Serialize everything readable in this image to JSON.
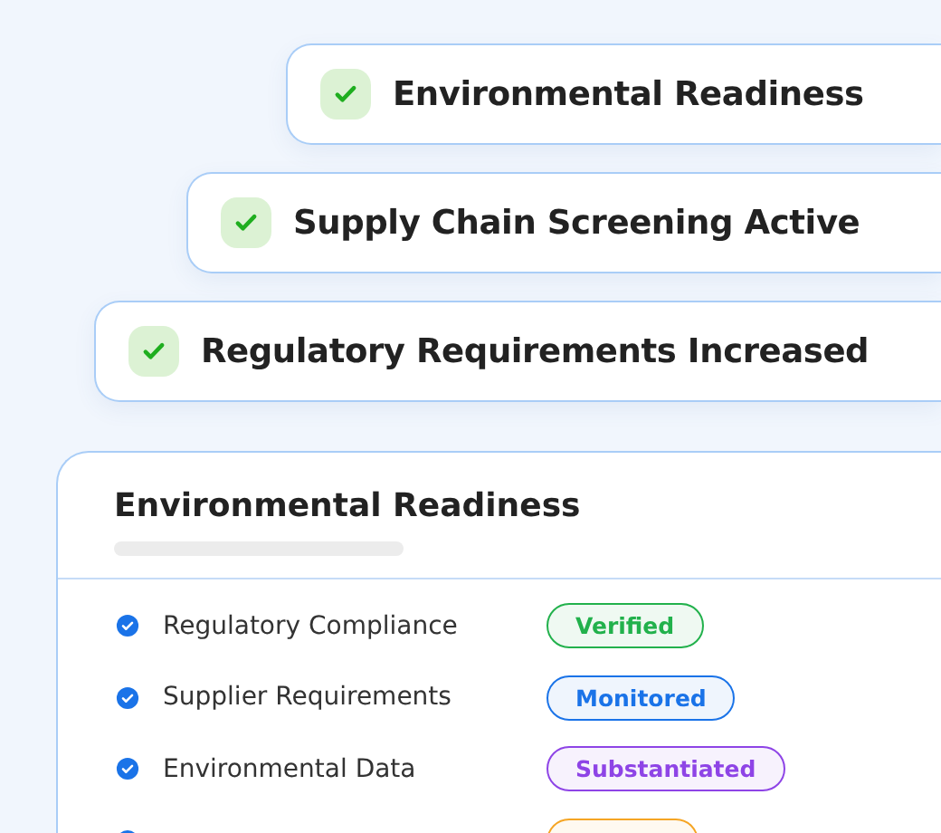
{
  "banners": [
    {
      "label": "Environmental Readiness",
      "checked": true
    },
    {
      "label": "Supply Chain Screening Active",
      "checked": true
    },
    {
      "label": "Regulatory Requirements Increased",
      "checked": true
    }
  ],
  "card": {
    "title": "Environmental Readiness",
    "rows": [
      {
        "label": "Regulatory Compliance",
        "checked": true,
        "status": "Verified",
        "color": "#22b14c"
      },
      {
        "label": "Supplier Requirements",
        "checked": true,
        "status": "Monitored",
        "color": "#1a73e8"
      },
      {
        "label": "Environmental Data",
        "checked": true,
        "status": "Substantiated",
        "color": "#8e44e6"
      },
      {
        "checked": true,
        "color": "#f5a524"
      }
    ]
  }
}
